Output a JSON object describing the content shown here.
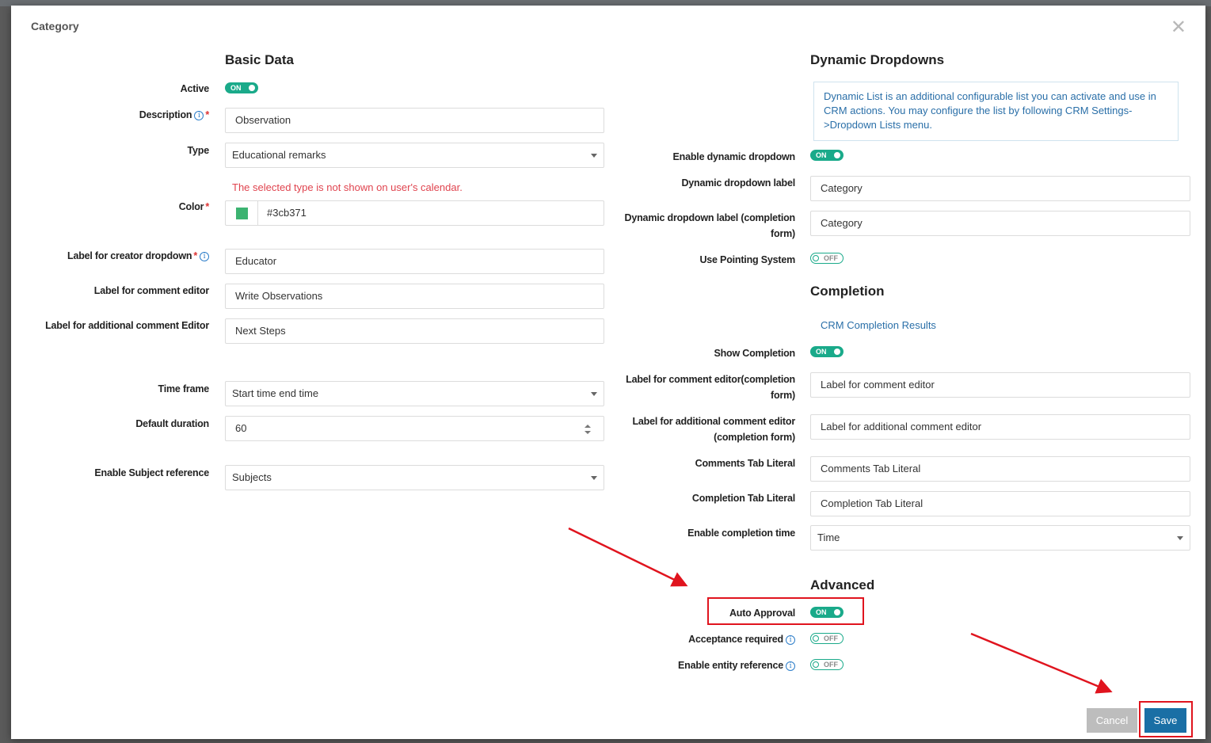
{
  "dialog": {
    "title": "Category",
    "close_symbol": "✕"
  },
  "basic": {
    "section_title": "Basic Data",
    "active": {
      "label": "Active",
      "toggle": "ON"
    },
    "description": {
      "label": "Description",
      "required": "*",
      "value": "Observation"
    },
    "type": {
      "label": "Type",
      "value": "Educational remarks",
      "warning": "The selected type is not shown on user's calendar."
    },
    "color": {
      "label": "Color",
      "required": "*",
      "value": "#3cb371",
      "swatch": "#3cb371"
    },
    "creator_dropdown": {
      "label": "Label for creator dropdown",
      "required": "*",
      "value": "Educator"
    },
    "comment_editor": {
      "label": "Label for comment editor",
      "value": "Write Observations"
    },
    "additional_comment_editor": {
      "label": "Label for additional comment Editor",
      "value": "Next Steps"
    },
    "time_frame": {
      "label": "Time frame",
      "value": "Start time end time"
    },
    "default_duration": {
      "label": "Default duration",
      "value": "60"
    },
    "subject_reference": {
      "label": "Enable Subject reference",
      "value": "Subjects"
    }
  },
  "dynamic": {
    "section_title": "Dynamic Dropdowns",
    "info": "Dynamic List is an additional configurable list you can activate and use in CRM actions. You may configure the list by following CRM Settings->Dropdown Lists menu.",
    "enable": {
      "label": "Enable dynamic dropdown",
      "toggle": "ON"
    },
    "label": {
      "label": "Dynamic dropdown label",
      "value": "Category"
    },
    "label_completion": {
      "label_line1": "Dynamic dropdown label (completion",
      "label_line2": "form)",
      "value": "Category"
    },
    "pointing_system": {
      "label": "Use Pointing System",
      "toggle": "OFF"
    }
  },
  "completion": {
    "section_title": "Completion",
    "link": "CRM Completion Results",
    "show": {
      "label": "Show Completion",
      "toggle": "ON"
    },
    "comment_editor": {
      "label_line1": "Label for comment editor(completion",
      "label_line2": "form)",
      "value": "Label for comment editor"
    },
    "additional_comment_editor": {
      "label_line1": "Label for additional comment editor",
      "label_line2": "(completion form)",
      "value": "Label for additional comment editor"
    },
    "comments_tab": {
      "label": "Comments Tab Literal",
      "value": "Comments Tab Literal"
    },
    "completion_tab": {
      "label": "Completion Tab Literal",
      "value": "Completion Tab Literal"
    },
    "completion_time": {
      "label": "Enable completion time",
      "value": "Time"
    }
  },
  "advanced": {
    "section_title": "Advanced",
    "auto_approval": {
      "label": "Auto Approval",
      "toggle": "ON"
    },
    "acceptance_required": {
      "label": "Acceptance required",
      "toggle": "OFF"
    },
    "entity_reference": {
      "label": "Enable entity reference",
      "toggle": "OFF"
    }
  },
  "footer": {
    "cancel": "Cancel",
    "save": "Save"
  },
  "icons": {
    "info": "i"
  },
  "colors": {
    "toggle_on": "#1aaa8a",
    "primary": "#1a6fa5",
    "warning": "#e0444f",
    "annotation": "#e0141e"
  }
}
